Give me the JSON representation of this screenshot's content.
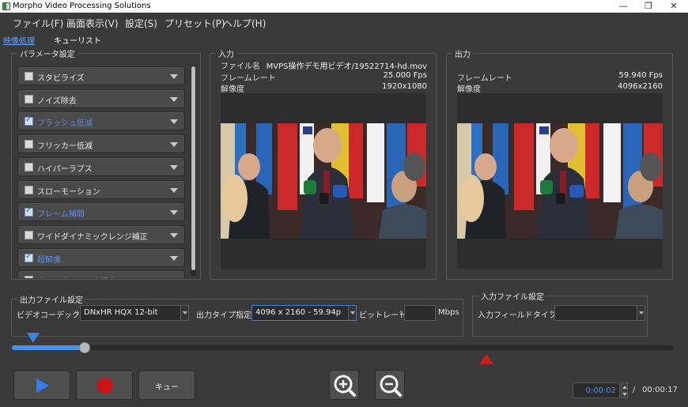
{
  "window": {
    "title": "Morpho Video Processing Solutions",
    "minimize": "—",
    "restore": "❐",
    "close": "✕"
  },
  "menu": [
    "ファイル(F)",
    "画面表示(V)",
    "設定(S)",
    "プリセット(P)",
    "ヘルプ(H)"
  ],
  "tabs": {
    "processing": "映像処理",
    "queue": "キューリスト"
  },
  "params": {
    "title": "パラメータ設定",
    "items": [
      {
        "label": "スタビライズ",
        "checked": false
      },
      {
        "label": "ノイズ除去",
        "checked": false
      },
      {
        "label": "フラッシュ低減",
        "checked": true
      },
      {
        "label": "フリッカー低減",
        "checked": false
      },
      {
        "label": "ハイパーラプス",
        "checked": false
      },
      {
        "label": "スローモーション",
        "checked": false
      },
      {
        "label": "フレーム補間",
        "checked": true
      },
      {
        "label": "ワイドダイナミックレンジ補正",
        "checked": false
      },
      {
        "label": "超解像",
        "checked": true
      },
      {
        "label": "ウォーターマーク設定",
        "checked": false
      }
    ]
  },
  "input": {
    "title": "入力",
    "filename_label": "ファイル名",
    "filename": "MVPS操作デモ用ビデオ/19522714-hd.mov",
    "framerate_label": "フレームレート",
    "framerate": "25.000 Fps",
    "resolution_label": "解像度",
    "resolution": "1920x1080"
  },
  "output": {
    "title": "出力",
    "framerate_label": "フレームレート",
    "framerate": "59.940 Fps",
    "resolution_label": "解像度",
    "resolution": "4096x2160"
  },
  "output_file": {
    "title": "出力ファイル設定",
    "codec_label": "ビデオコーデック",
    "codec": "DNxHR HQX 12-bit",
    "type_label": "出力タイプ指定",
    "type": "4096 x 2160 - 59.94p",
    "bitrate_label": "ビットレート",
    "bitrate": "",
    "bitrate_unit": "Mbps"
  },
  "input_file": {
    "title": "入力ファイル設定",
    "field_label": "入力フィールドタイプ",
    "field": ""
  },
  "playback": {
    "progress": 0.11,
    "queue_label": "キュー",
    "current_time": "0:00:02",
    "separator": "/",
    "total_time": "00:00:17"
  },
  "colors": {
    "accent": "#4a8fe8",
    "record": "#cc1414",
    "bg": "#3a3a3a"
  },
  "icons": {
    "play": "play-icon",
    "record": "record-icon",
    "zoom_in": "zoom-in-icon",
    "zoom_out": "zoom-out-icon"
  }
}
